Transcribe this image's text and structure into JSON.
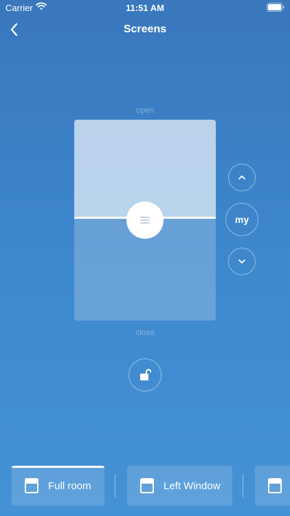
{
  "status_bar": {
    "carrier": "Carrier",
    "time": "11:51 AM",
    "wifi_icon": "wifi-icon",
    "battery_icon": "battery-icon"
  },
  "nav": {
    "title": "Screens",
    "back_icon": "chevron-left-icon"
  },
  "screen_control": {
    "open_label": "open",
    "close_label": "close",
    "position_closed_fraction": 0.49,
    "up_icon": "chevron-up-icon",
    "my_label": "my",
    "down_icon": "chevron-down-icon",
    "handle_icon": "menu-lines-icon",
    "lock_icon": "unlocked-padlock-icon"
  },
  "groups": [
    {
      "label": "Full room",
      "icon": "window-icon",
      "active": true
    },
    {
      "label": "Left Window",
      "icon": "window-icon",
      "active": false
    },
    {
      "label": "",
      "icon": "window-icon",
      "active": false
    }
  ],
  "colors": {
    "background_top": "#3a77bd",
    "background_bottom": "#4592d6",
    "accent": "#ffffff"
  }
}
